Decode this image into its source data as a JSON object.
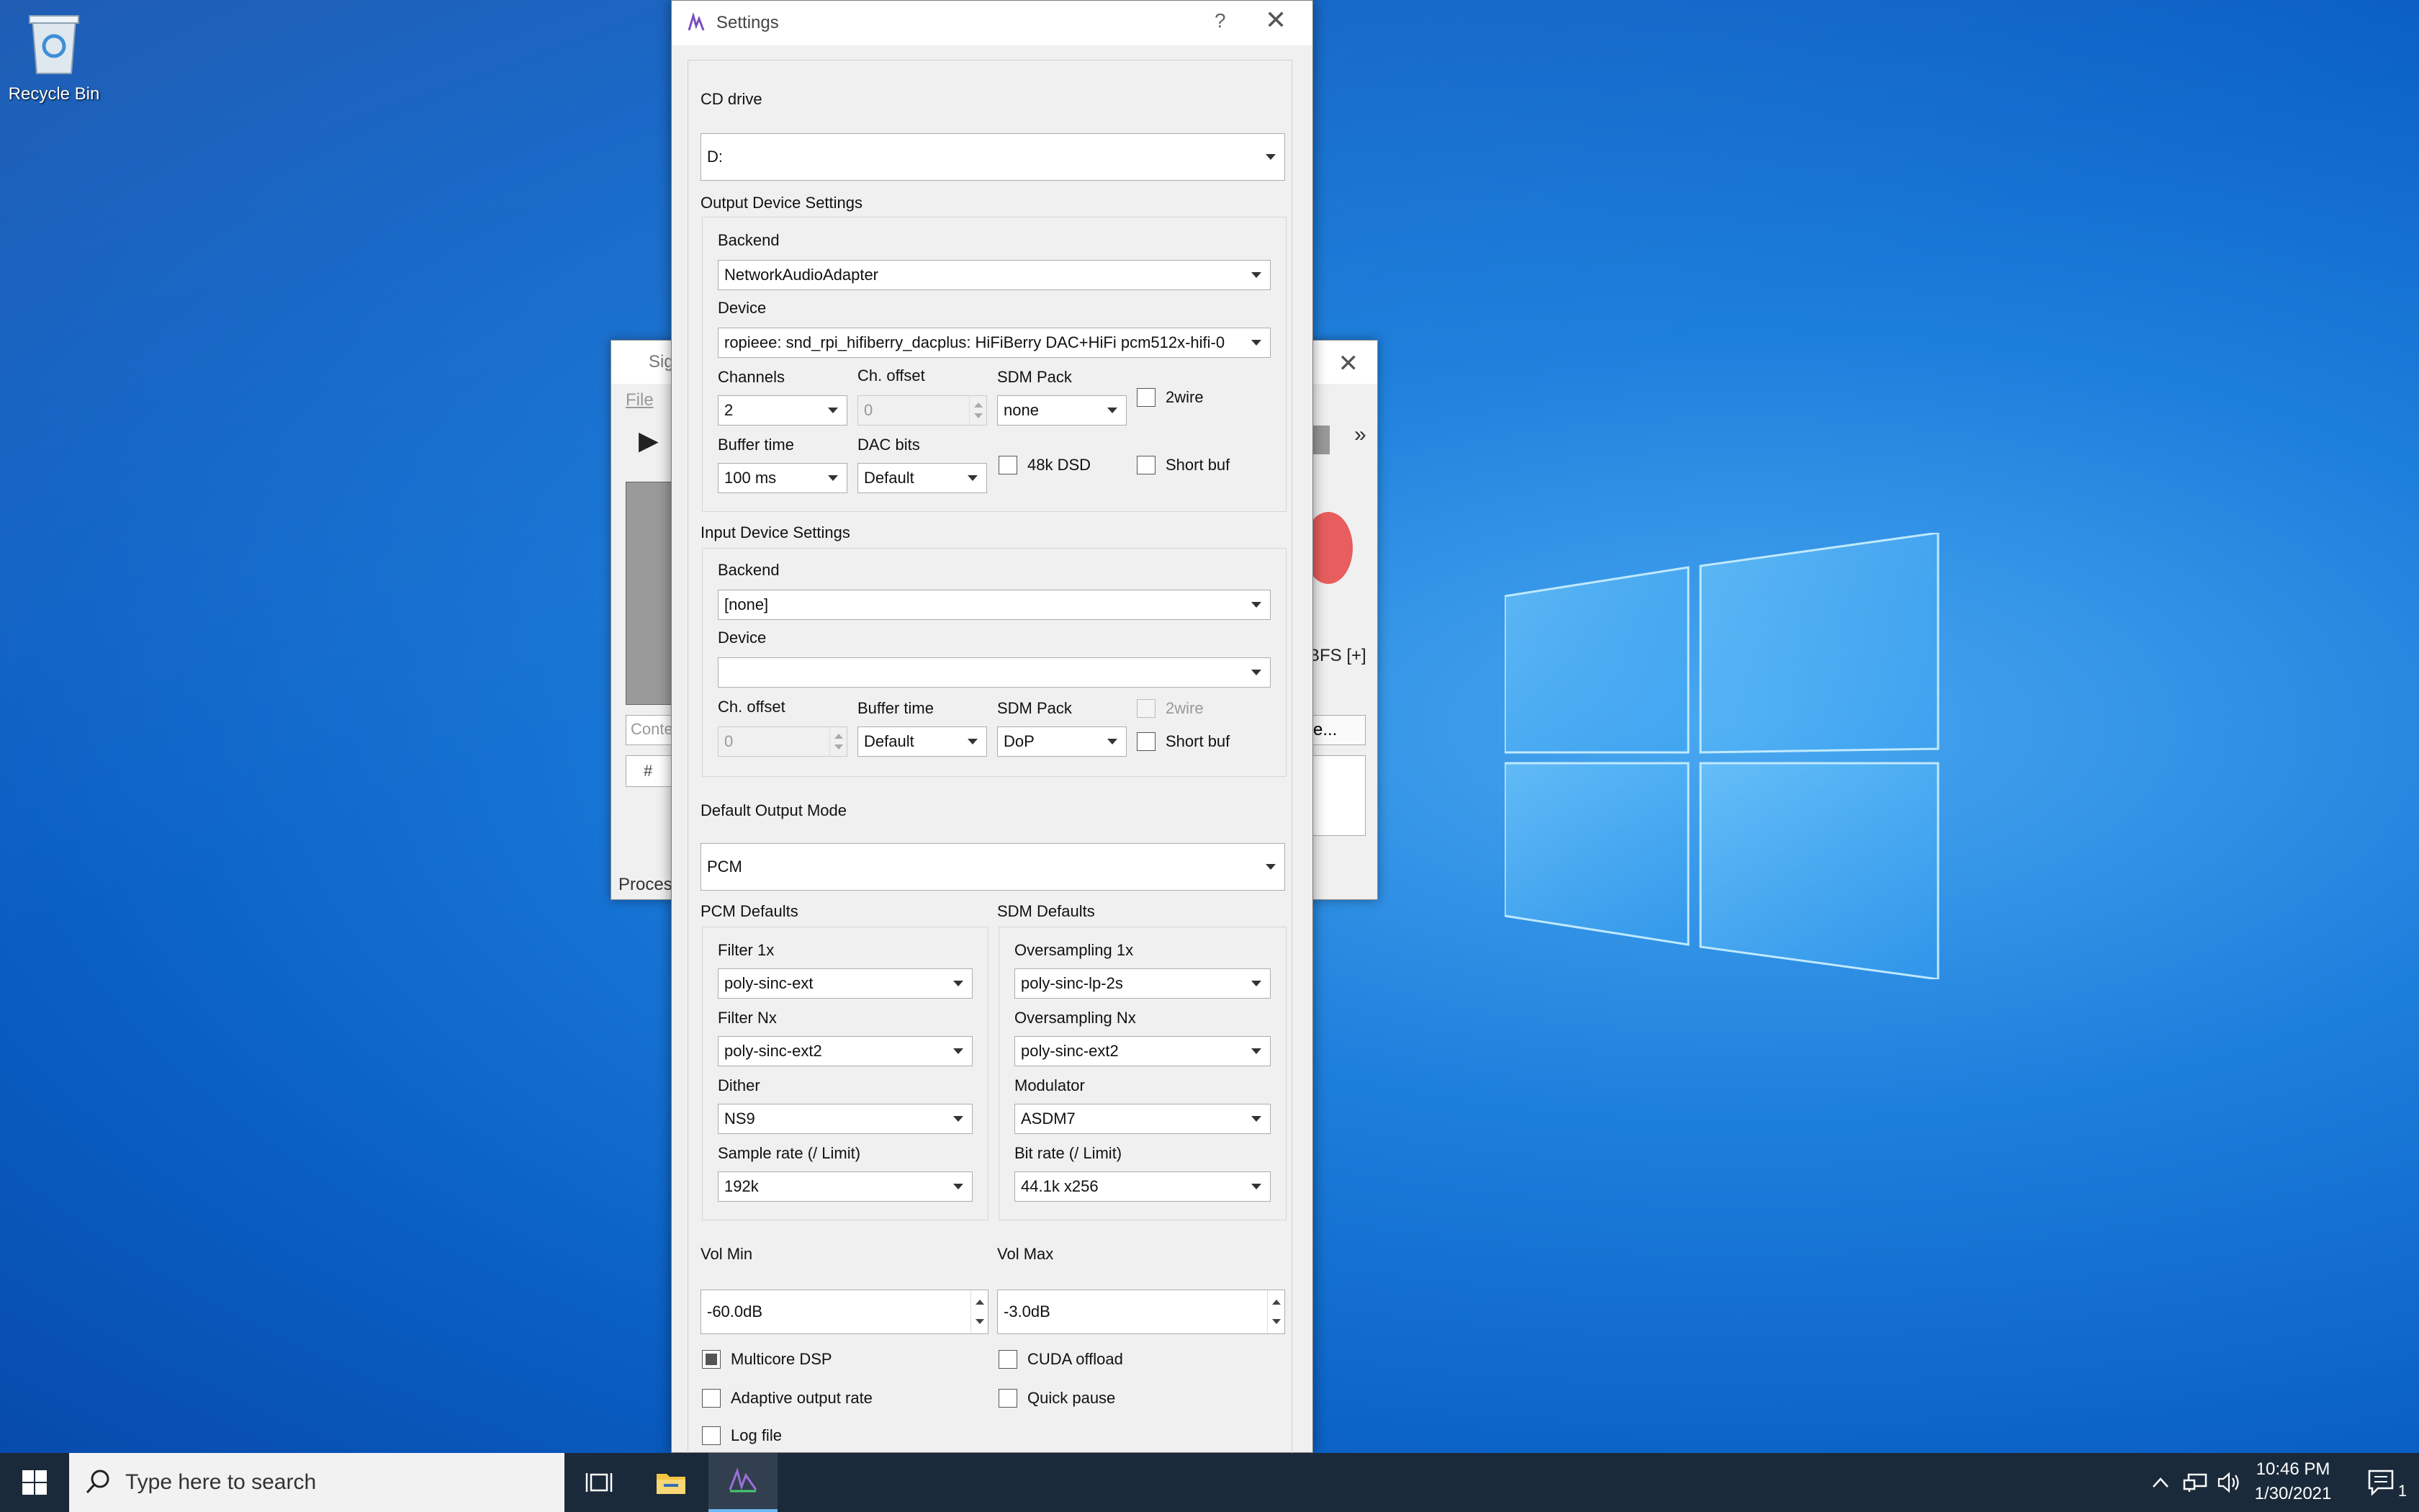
{
  "desktop": {
    "recycle_bin_label": "Recycle Bin"
  },
  "background_window": {
    "title": "Sig",
    "menu_file": "File",
    "filter_placeholder": "Conte",
    "table_header": "#",
    "status": "Process",
    "dbfs_label": "BFS [+]",
    "button_text": "e..."
  },
  "dialog": {
    "title": "Settings",
    "help_label": "?",
    "cd_drive": {
      "label": "CD drive",
      "value": "D:"
    },
    "output_device": {
      "section_label": "Output Device Settings",
      "backend_label": "Backend",
      "backend_value": "NetworkAudioAdapter",
      "device_label": "Device",
      "device_value": "ropieee: snd_rpi_hifiberry_dacplus: HiFiBerry DAC+HiFi pcm512x-hifi-0",
      "channels_label": "Channels",
      "channels_value": "2",
      "ch_offset_label": "Ch. offset",
      "ch_offset_value": "0",
      "sdm_pack_label": "SDM Pack",
      "sdm_pack_value": "none",
      "two_wire_label": "2wire",
      "buffer_time_label": "Buffer time",
      "buffer_time_value": "100 ms",
      "dac_bits_label": "DAC bits",
      "dac_bits_value": "Default",
      "dsd48k_label": "48k DSD",
      "short_buf_label": "Short buf"
    },
    "input_device": {
      "section_label": "Input Device Settings",
      "backend_label": "Backend",
      "backend_value": "[none]",
      "device_label": "Device",
      "device_value": "",
      "ch_offset_label": "Ch. offset",
      "ch_offset_value": "0",
      "buffer_time_label": "Buffer time",
      "buffer_time_value": "Default",
      "sdm_pack_label": "SDM Pack",
      "sdm_pack_value": "DoP",
      "two_wire_label": "2wire",
      "short_buf_label": "Short buf"
    },
    "default_output_mode": {
      "label": "Default Output Mode",
      "value": "PCM"
    },
    "pcm_defaults": {
      "section_label": "PCM Defaults",
      "filter1x_label": "Filter 1x",
      "filter1x_value": "poly-sinc-ext",
      "filternx_label": "Filter Nx",
      "filternx_value": "poly-sinc-ext2",
      "dither_label": "Dither",
      "dither_value": "NS9",
      "sample_rate_label": "Sample rate (/ Limit)",
      "sample_rate_value": "192k"
    },
    "sdm_defaults": {
      "section_label": "SDM Defaults",
      "os1x_label": "Oversampling 1x",
      "os1x_value": "poly-sinc-lp-2s",
      "osnx_label": "Oversampling Nx",
      "osnx_value": "poly-sinc-ext2",
      "modulator_label": "Modulator",
      "modulator_value": "ASDM7",
      "bit_rate_label": "Bit rate (/ Limit)",
      "bit_rate_value": "44.1k x256"
    },
    "vol_min": {
      "label": "Vol Min",
      "value": "-60.0dB"
    },
    "vol_max": {
      "label": "Vol Max",
      "value": "-3.0dB"
    },
    "checkboxes": {
      "multicore_dsp": "Multicore DSP",
      "cuda_offload": "CUDA offload",
      "adaptive_output_rate": "Adaptive output rate",
      "quick_pause": "Quick pause",
      "log_file": "Log file"
    }
  },
  "taskbar": {
    "search_placeholder": "Type here to search",
    "time": "10:46 PM",
    "date": "1/30/2021",
    "notification_count": "1"
  },
  "colors": {
    "desktop_blue": "#0a5fc4",
    "taskbar": "#1b2a3a",
    "active_indicator": "#6cb8f6",
    "dialog_bg": "#f0f0f0"
  }
}
